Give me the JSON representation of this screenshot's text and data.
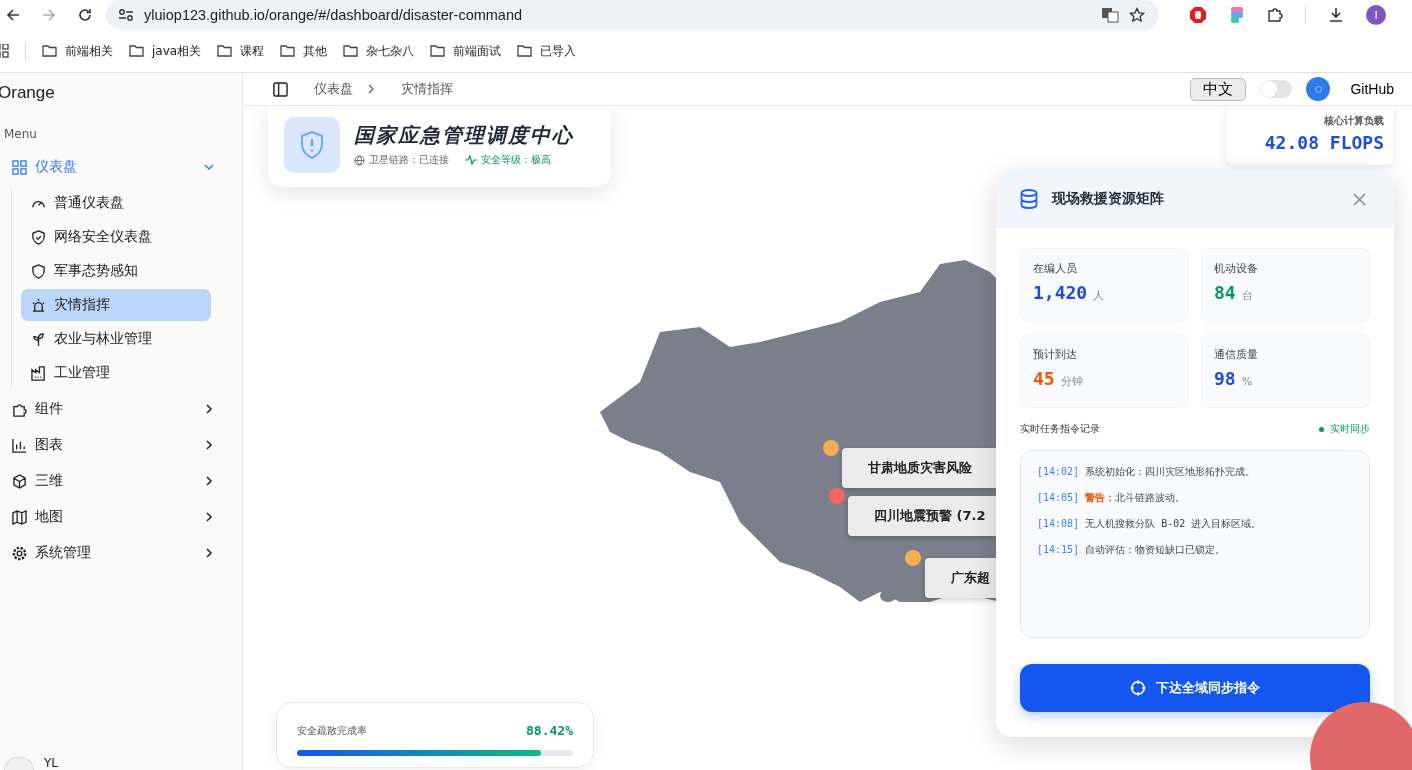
{
  "browser": {
    "url": "yluiop123.github.io/orange/#/dashboard/disaster-command",
    "avatar": "I",
    "bookmarks": [
      "前端相关",
      "java相关",
      "课程",
      "其他",
      "杂七杂八",
      "前端面试",
      "已导入"
    ]
  },
  "sidebar": {
    "brand": "Orange",
    "section": "Menu",
    "items": [
      {
        "label": "仪表盘",
        "expanded": true,
        "children": [
          {
            "label": "普通仪表盘",
            "selected": false
          },
          {
            "label": "网络安全仪表盘",
            "selected": false
          },
          {
            "label": "军事态势感知",
            "selected": false
          },
          {
            "label": "灾情指挥",
            "selected": true
          },
          {
            "label": "农业与林业管理",
            "selected": false
          },
          {
            "label": "工业管理",
            "selected": false
          }
        ]
      },
      {
        "label": "组件",
        "expanded": false
      },
      {
        "label": "图表",
        "expanded": false
      },
      {
        "label": "三维",
        "expanded": false
      },
      {
        "label": "地图",
        "expanded": false
      },
      {
        "label": "系统管理",
        "expanded": false
      }
    ],
    "user": "YL"
  },
  "header": {
    "breadcrumb": [
      "仪表盘",
      "灾情指挥"
    ],
    "language": "中文",
    "dark_mode": false,
    "link": "GitHub"
  },
  "title_card": {
    "title": "国家应急管理调度中心",
    "link_status": "卫星链路：已连接",
    "security": "安全等级：极高"
  },
  "compute_card": {
    "label": "核心计算负载",
    "value": "42.08 FLOPS"
  },
  "map": {
    "markers": [
      {
        "label": "甘肃地质灾害风险",
        "color": "#f6ad55"
      },
      {
        "label": "四川地震预警 (7.2",
        "color": "#f56565"
      },
      {
        "label": "广东超",
        "color": "#f6ad55"
      }
    ]
  },
  "progress": {
    "label": "安全疏散完成率",
    "reading": "88.42%",
    "level": 0.884
  },
  "panel": {
    "title": "现场救援资源矩阵",
    "stats": [
      {
        "label": "在编人员",
        "value": "1,420",
        "unit": "人",
        "color": "#1d4ed8"
      },
      {
        "label": "机动设备",
        "value": "84",
        "unit": "台",
        "color": "#059669"
      },
      {
        "label": "预计到达",
        "value": "45",
        "unit": "分钟",
        "color": "#ea580c"
      },
      {
        "label": "通信质量",
        "value": "98",
        "unit": "%",
        "color": "#1d4ed8"
      }
    ],
    "log_title": "实时任务指令记录",
    "sync": "实时同步",
    "logs": [
      {
        "kind": "info",
        "time": "[14:02]",
        "text": "系统初始化：四川灾区地形拓扑完成。"
      },
      {
        "kind": "warning",
        "time": "[14:05]",
        "prefix": "警告：",
        "text": "北斗链路波动。"
      },
      {
        "kind": "info",
        "time": "[14:08]",
        "text": "无人机搜救分队 B-02 进入目标区域。"
      },
      {
        "kind": "info",
        "time": "[14:15]",
        "text": "自动评估：物资短缺口已锁定。"
      }
    ],
    "action": "下达全域同步指令"
  }
}
